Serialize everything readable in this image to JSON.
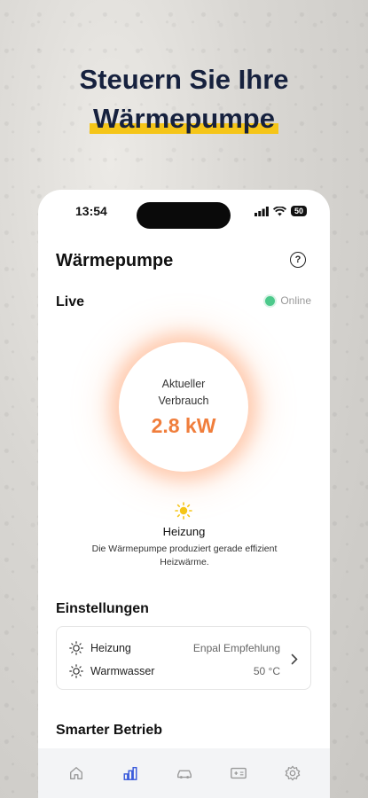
{
  "headline": {
    "line1": "Steuern Sie Ihre",
    "line2": "Wärmepumpe"
  },
  "status_bar": {
    "time": "13:54",
    "battery": "50"
  },
  "header": {
    "title": "Wärmepumpe",
    "help_icon": "question-circle-icon"
  },
  "live": {
    "label": "Live",
    "status": "Online",
    "status_color": "#4cc98b",
    "gauge_label_line1": "Aktueller",
    "gauge_label_line2": "Verbrauch",
    "gauge_value": "2.8 kW",
    "value_color": "#f07e3c",
    "mode_icon": "sun-icon",
    "mode": "Heizung",
    "description": "Die Wärmepumpe produziert gerade effizient Heizwärme."
  },
  "settings": {
    "title": "Einstellungen",
    "rows": [
      {
        "icon": "sun-icon",
        "label": "Heizung",
        "value": "Enpal Empfehlung"
      },
      {
        "icon": "sun-icon",
        "label": "Warmwasser",
        "value": "50 °C"
      }
    ]
  },
  "smart": {
    "title": "Smarter Betrieb"
  },
  "tabbar": {
    "items": [
      "home-icon",
      "chart-icon",
      "car-icon",
      "wallet-icon",
      "settings-icon"
    ],
    "active_index": 1,
    "active_color": "#3b5bdb"
  }
}
